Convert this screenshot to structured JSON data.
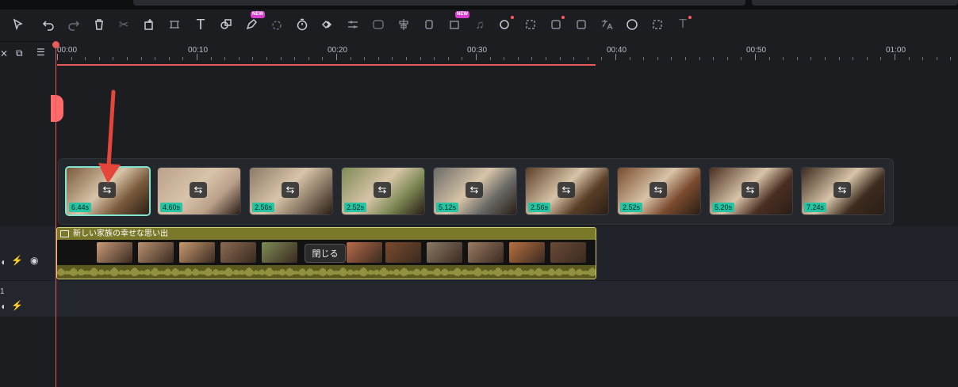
{
  "toolbar": {
    "badge_new_small": "NEW",
    "badge_new": "NEW"
  },
  "ruler": {
    "labels": [
      "00:00",
      "00:10",
      "00:20",
      "00:30",
      "00:40",
      "00:50",
      "01:00"
    ]
  },
  "popup_clips": [
    {
      "duration": "6.44s",
      "selected": true,
      "color": "#7a5a3c"
    },
    {
      "duration": "4.60s",
      "selected": false,
      "color": "#b9a08a"
    },
    {
      "duration": "2.56s",
      "selected": false,
      "color": "#8b7a66"
    },
    {
      "duration": "2.52s",
      "selected": false,
      "color": "#7e8a55"
    },
    {
      "duration": "5.12s",
      "selected": false,
      "color": "#6a6a66"
    },
    {
      "duration": "2.56s",
      "selected": false,
      "color": "#5a3e26"
    },
    {
      "duration": "2.52s",
      "selected": false,
      "color": "#7a4a2e"
    },
    {
      "duration": "5.20s",
      "selected": false,
      "color": "#4a2e22"
    },
    {
      "duration": "7.24s",
      "selected": false,
      "color": "#3c2a1e"
    }
  ],
  "compound_clip": {
    "title": "新しい家族の幸せな思い出",
    "close_label": "閉じる"
  },
  "track2": {
    "label": "1"
  },
  "colors": {
    "accent_red": "#e85a5a",
    "selected_border": "#7fe3cf",
    "duration_badge": "#26c4a3",
    "compound_clip": "#7a7829"
  }
}
